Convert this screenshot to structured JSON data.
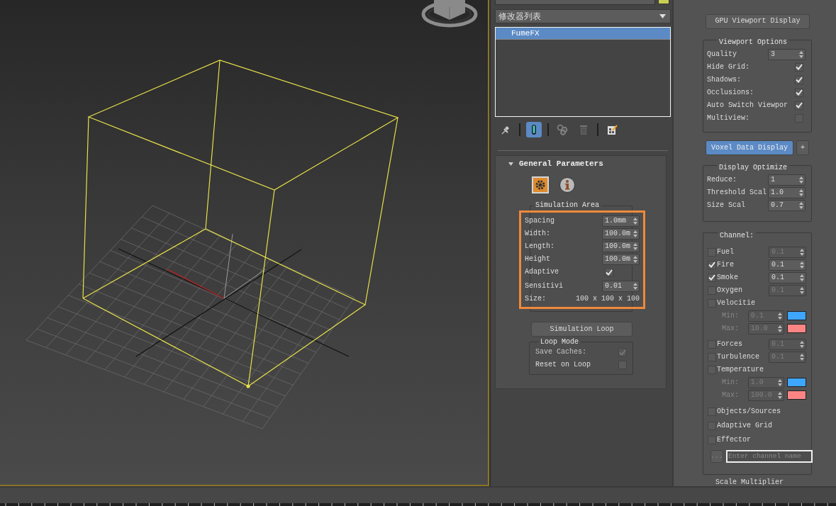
{
  "modifier_list": {
    "value": "修改器列表"
  },
  "modifier_stack": [
    {
      "label": "FumeFX",
      "selected": true
    }
  ],
  "stack_toolbar": [
    {
      "kind": "pin",
      "selected": false
    },
    {
      "kind": "end-result",
      "selected": true
    },
    {
      "kind": "unique",
      "selected": false
    },
    {
      "kind": "remove",
      "selected": false
    },
    {
      "kind": "configure",
      "selected": false
    }
  ],
  "general_parameters": {
    "title": "General Parameters",
    "expanded": true,
    "tabs": [
      {
        "kind": "settings",
        "selected": true
      },
      {
        "kind": "info",
        "selected": false
      }
    ],
    "simulation_area": {
      "title": "Simulation Area",
      "highlighted": true,
      "rows": [
        {
          "kind": "spinner",
          "label": "Spacing",
          "value": "1.0mm"
        },
        {
          "kind": "spinner",
          "label": "Width:",
          "value": "100.0m"
        },
        {
          "kind": "spinner",
          "label": "Length:",
          "value": "100.0m"
        },
        {
          "kind": "spinner",
          "label": "Height",
          "value": "100.0m"
        },
        {
          "kind": "checkbox",
          "label": "Adaptive",
          "checked": true
        },
        {
          "kind": "spinner",
          "label": "Sensitivi",
          "value": "0.01"
        },
        {
          "kind": "text",
          "label": "Size:",
          "value": "100 x 100 x 100"
        }
      ]
    },
    "loop_button": "Simulation Loop",
    "loop_mode": {
      "title": "Loop Mode",
      "rows": [
        {
          "kind": "checkbox",
          "label": "Save Caches:",
          "checked": true,
          "disabled": true
        },
        {
          "kind": "checkbox",
          "label": "Reset on Loop",
          "checked": false,
          "disabled": false
        }
      ]
    }
  },
  "gpu_button": "GPU Viewport Display",
  "viewport_options": {
    "title": "Viewport Options",
    "rows": [
      {
        "kind": "spinner",
        "label": "Quality",
        "value": "3"
      },
      {
        "kind": "checkbox",
        "label": "Hide Grid:",
        "checked": true
      },
      {
        "kind": "checkbox",
        "label": "Shadows:",
        "checked": true
      },
      {
        "kind": "checkbox",
        "label": "Occlusions:",
        "checked": true
      },
      {
        "kind": "checkbox",
        "label": "Auto Switch Viewpor",
        "checked": true
      },
      {
        "kind": "checkbox",
        "label": "Multiview:",
        "checked": false
      }
    ]
  },
  "voxel_button": {
    "label": "Voxel Data Display",
    "selected": true
  },
  "add_button": "+",
  "display_optimize": {
    "title": "Display Optimize",
    "rows": [
      {
        "kind": "spinner",
        "label": "Reduce:",
        "value": "1"
      },
      {
        "kind": "spinner",
        "label": "Threshold Scal",
        "value": "1.0"
      },
      {
        "kind": "spinner",
        "label": "Size Scal",
        "value": "0.7"
      }
    ]
  },
  "channel": {
    "title": "Channel:",
    "rows": [
      {
        "kind": "spinner",
        "label": "Fuel",
        "checked": false,
        "value": "0.1"
      },
      {
        "kind": "spinner",
        "label": "Fire",
        "checked": true,
        "value": "0.1"
      },
      {
        "kind": "spinner",
        "label": "Smoke",
        "checked": true,
        "value": "0.1"
      },
      {
        "kind": "spinner",
        "label": "Oxygen",
        "checked": false,
        "value": "0.1"
      },
      {
        "kind": "range",
        "label": "Velocitie",
        "checked": false,
        "children": [
          {
            "label": "Min:",
            "value": "0.1",
            "color": "#3ea6ff"
          },
          {
            "label": "Max:",
            "value": "10.0",
            "color": "#ff8585"
          }
        ]
      },
      {
        "kind": "spinner",
        "label": "Forces",
        "checked": false,
        "value": "0.1"
      },
      {
        "kind": "spinner",
        "label": "Turbulence",
        "checked": false,
        "value": "0.1"
      },
      {
        "kind": "range",
        "label": "Temperature",
        "checked": false,
        "children": [
          {
            "label": "Min:",
            "value": "1.0",
            "color": "#3ea6ff"
          },
          {
            "label": "Max:",
            "value": "100.0",
            "color": "#ff8585"
          }
        ]
      },
      {
        "kind": "plain",
        "label": "Objects/Sources",
        "checked": false
      },
      {
        "kind": "plain",
        "label": "Adaptive Grid",
        "checked": false
      },
      {
        "kind": "plain",
        "label": "Effector",
        "checked": false
      }
    ],
    "browse_button": "...",
    "name_field": {
      "placeholder": "Enter channel name"
    }
  },
  "scale_multiplier": {
    "title": "Scale Multiplier"
  }
}
